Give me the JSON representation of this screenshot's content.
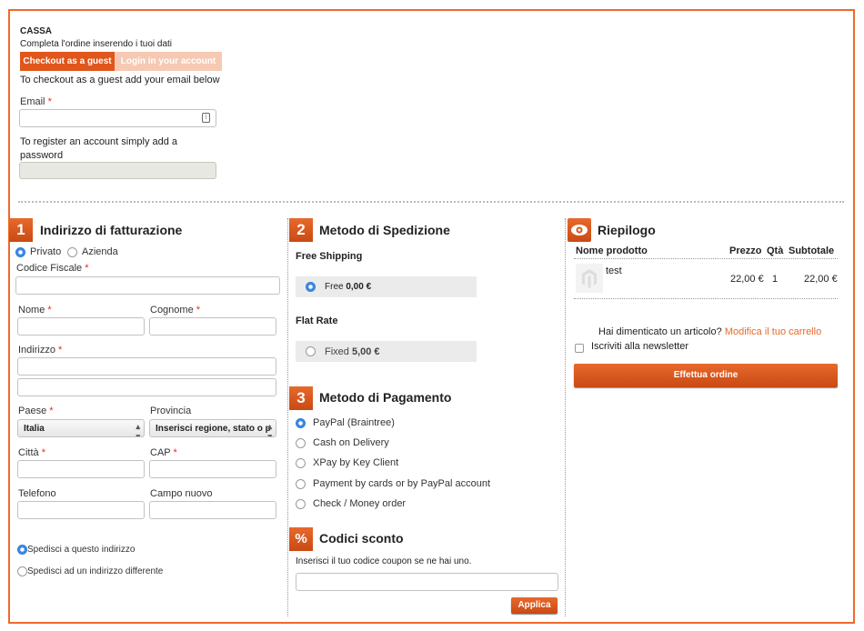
{
  "header": {
    "title": "CASSA",
    "subtitle": "Completa l'ordine inserendo i tuoi dati",
    "tab_guest": "Checkout as a guest",
    "tab_login": "Login in your account",
    "guest_hint": "To checkout as a guest add your email below",
    "email_label": "Email",
    "register_hint_1": "To register an account simply add a",
    "register_hint_2": "password"
  },
  "billing": {
    "step": "1",
    "title": "Indirizzo di fatturazione",
    "type_private": "Privato",
    "type_company": "Azienda",
    "fiscal_code": "Codice Fiscale",
    "first_name": "Nome",
    "last_name": "Cognome",
    "address": "Indirizzo",
    "country": "Paese",
    "country_value": "Italia",
    "province": "Provincia",
    "province_value": "Inserisci regione, stato o p",
    "city": "Città",
    "zip": "CAP",
    "phone": "Telefono",
    "new_field": "Campo nuovo",
    "ship_same": "Spedisci a questo indirizzo",
    "ship_diff": "Spedisci ad un indirizzo differente"
  },
  "shipping": {
    "step": "2",
    "title": "Metodo di Spedizione",
    "methods": [
      {
        "group": "Free Shipping",
        "name": "Free",
        "price": "0,00 €",
        "selected": true
      },
      {
        "group": "Flat Rate",
        "name": "Fixed",
        "price": "5,00 €",
        "selected": false
      }
    ]
  },
  "payment": {
    "step": "3",
    "title": "Metodo di Pagamento",
    "methods": [
      "PayPal (Braintree)",
      "Cash on Delivery",
      "XPay by Key Client",
      "Payment by cards or by PayPal account",
      "Check / Money order"
    ],
    "selected_index": 0
  },
  "coupon": {
    "icon": "%",
    "title": "Codici sconto",
    "hint": "Inserisci il tuo codice coupon se ne hai uno.",
    "apply": "Applica"
  },
  "summary": {
    "title": "Riepilogo",
    "col_name": "Nome prodotto",
    "col_price": "Prezzo",
    "col_qty": "Qtà",
    "col_subtotal": "Subtotale",
    "item_name": "test",
    "item_price": "22,00 €",
    "item_qty": "1",
    "item_subtotal": "22,00 €",
    "forgot": "Hai dimenticato un articolo?",
    "edit_cart": "Modifica il tuo carrello",
    "newsletter": "Iscriviti alla newsletter",
    "place_order": "Effettua ordine"
  },
  "colors": {
    "accent": "#e8692b",
    "frame": "#f0692a",
    "link": "#e8692b",
    "selected_radio": "#3b8ae6"
  }
}
